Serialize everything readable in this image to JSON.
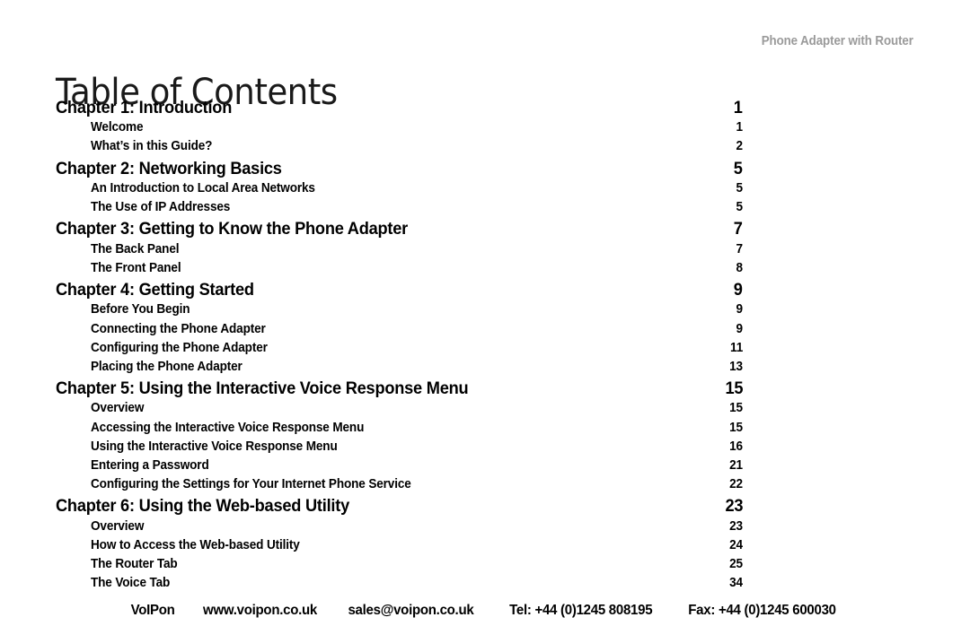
{
  "header": {
    "running_title": "Phone Adapter with Router"
  },
  "page_title": "Table of Contents",
  "toc": {
    "entries": [
      {
        "level": "chapter",
        "label": "Chapter 1: Introduction",
        "page": "1"
      },
      {
        "level": "section",
        "label": "Welcome",
        "page": "1"
      },
      {
        "level": "section",
        "label": "What’s in this Guide?",
        "page": "2"
      },
      {
        "level": "chapter",
        "label": "Chapter 2: Networking Basics",
        "page": "5"
      },
      {
        "level": "section",
        "label": "An Introduction to Local Area Networks",
        "page": "5"
      },
      {
        "level": "section",
        "label": "The Use of IP Addresses",
        "page": "5"
      },
      {
        "level": "chapter",
        "label": "Chapter 3: Getting to Know the Phone Adapter",
        "page": "7"
      },
      {
        "level": "section",
        "label": "The Back Panel",
        "page": "7"
      },
      {
        "level": "section",
        "label": "The Front Panel",
        "page": "8"
      },
      {
        "level": "chapter",
        "label": "Chapter 4: Getting Started",
        "page": "9"
      },
      {
        "level": "section",
        "label": "Before You Begin",
        "page": "9"
      },
      {
        "level": "section",
        "label": "Connecting the Phone Adapter",
        "page": "9"
      },
      {
        "level": "section",
        "label": "Configuring the Phone Adapter",
        "page": "11"
      },
      {
        "level": "section",
        "label": "Placing the Phone Adapter",
        "page": "13"
      },
      {
        "level": "chapter",
        "label": "Chapter 5: Using the Interactive Voice Response Menu",
        "page": "15"
      },
      {
        "level": "section",
        "label": "Overview",
        "page": "15"
      },
      {
        "level": "section",
        "label": "Accessing the Interactive Voice Response Menu",
        "page": "15"
      },
      {
        "level": "section",
        "label": "Using the Interactive Voice Response Menu",
        "page": "16"
      },
      {
        "level": "section",
        "label": "Entering a Password",
        "page": "21"
      },
      {
        "level": "section",
        "label": "Configuring the Settings for Your Internet Phone Service",
        "page": "22"
      },
      {
        "level": "chapter",
        "label": "Chapter 6: Using the Web-based Utility",
        "page": "23"
      },
      {
        "level": "section",
        "label": "Overview",
        "page": "23"
      },
      {
        "level": "section",
        "label": "How to Access the Web-based Utility",
        "page": "24"
      },
      {
        "level": "section",
        "label": "The Router Tab",
        "page": "25"
      },
      {
        "level": "section",
        "label": "The Voice Tab",
        "page": "34"
      }
    ]
  },
  "footer": {
    "company": "VoIPon",
    "website": "www.voipon.co.uk",
    "email": "sales@voipon.co.uk",
    "telephone": "Tel: +44 (0)1245 808195",
    "fax": "Fax: +44 (0)1245 600030"
  },
  "colors": {
    "page_background": "#ffffff",
    "body_text": "#000000",
    "running_header_text": "#9a9a9a",
    "title_text": "#1a1a1a"
  }
}
